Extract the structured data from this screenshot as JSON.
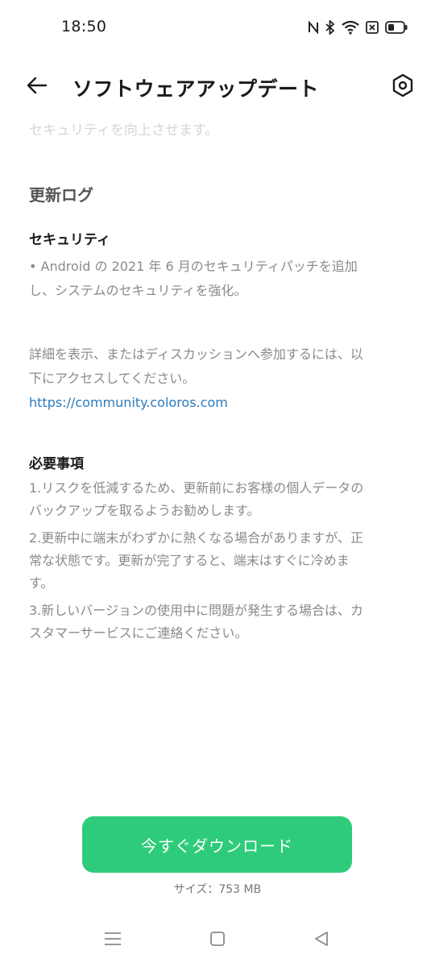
{
  "status_bar": {
    "time": "18:50",
    "icons": [
      "nfc-icon",
      "bluetooth-icon",
      "wifi-icon",
      "no-sim-icon",
      "battery-icon"
    ]
  },
  "app_bar": {
    "title": "ソフトウェアアップデート",
    "back_icon": "arrow-left-icon",
    "settings_icon": "hexagon-gear-icon"
  },
  "content": {
    "faded_text": "セキュリティを向上させます。",
    "changelog_heading": "更新ログ",
    "security_heading": "セキュリティ",
    "security_lines": [
      "• Android の 2021 年 6 月のセキュリティパッチを追加",
      "し、システムのセキュリティを強化。"
    ],
    "details_lines": [
      "詳細を表示、またはディスカッションへ参加するには、以",
      "下にアクセスしてください。"
    ],
    "community_link": "https://community.coloros.com",
    "requirements_heading": "必要事項",
    "requirements": [
      [
        "1.リスクを低減するため、更新前にお客様の個人データの",
        "バックアップを取るようお勧めします。"
      ],
      [
        "2.更新中に端末がわずかに熱くなる場合がありますが、正",
        "常な状態です。更新が完了すると、端末はすぐに冷めま",
        "す。"
      ],
      [
        "3.新しいバージョンの使用中に問題が発生する場合は、カ",
        "スタマーサービスにご連絡ください。"
      ]
    ]
  },
  "download": {
    "button_label": "今すぐダウンロード",
    "size_label": "サイズ：753 MB",
    "accent_color": "#2ecc7a"
  },
  "nav_bar": {
    "icons": [
      "menu-icon",
      "home-icon",
      "back-triangle-icon"
    ]
  }
}
